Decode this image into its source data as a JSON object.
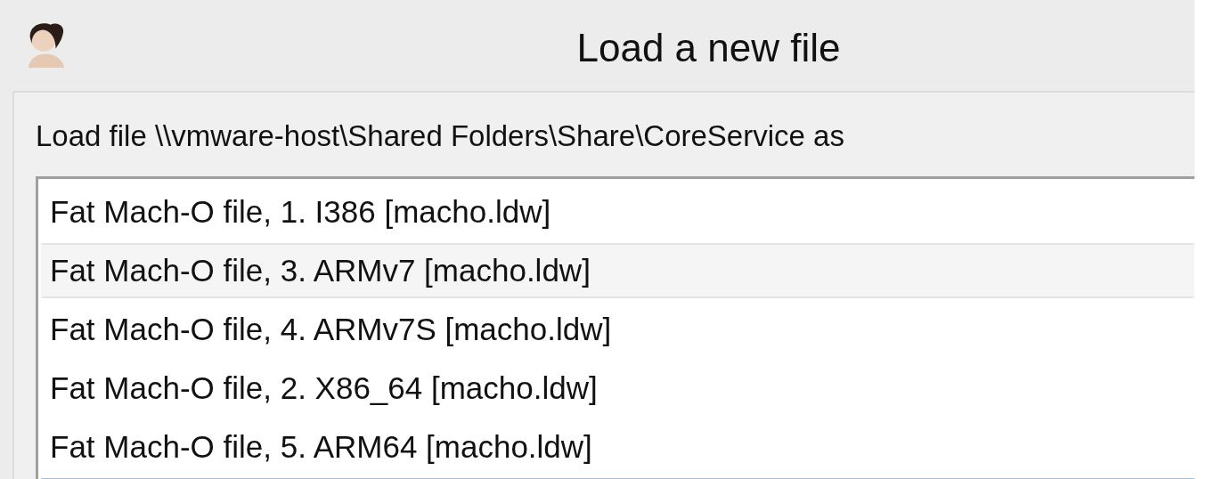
{
  "window": {
    "title": "Load a new file"
  },
  "prompt": "Load file \\\\vmware-host\\Shared Folders\\Share\\CoreService as",
  "loaders": [
    {
      "label": "Fat Mach-O file, 1. I386 [macho.ldw]",
      "highlighted": false,
      "selected": false
    },
    {
      "label": "Fat Mach-O file, 3. ARMv7 [macho.ldw]",
      "highlighted": true,
      "selected": false
    },
    {
      "label": "Fat Mach-O file, 4. ARMv7S [macho.ldw]",
      "highlighted": false,
      "selected": false
    },
    {
      "label": "Fat Mach-O file, 2. X86_64 [macho.ldw]",
      "highlighted": false,
      "selected": false
    },
    {
      "label": "Fat Mach-O file, 5. ARM64 [macho.ldw]",
      "highlighted": false,
      "selected": false
    },
    {
      "highlighted": false,
      "selected": true
    }
  ]
}
